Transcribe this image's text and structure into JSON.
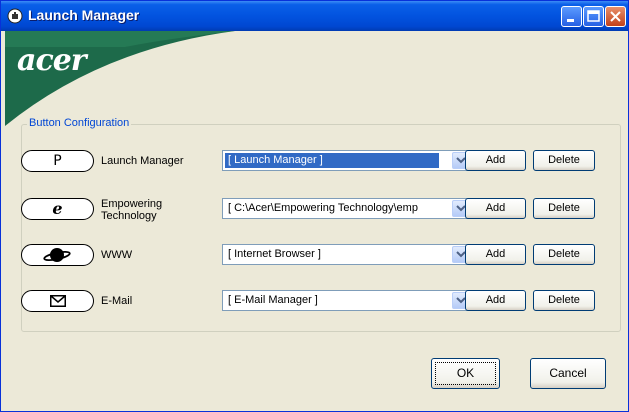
{
  "window": {
    "title": "Launch Manager",
    "brand": "acer",
    "colors": {
      "titlebar": "#0253df",
      "banner": "#1d6a4a",
      "legend": "#0046d5",
      "selection": "#316ac5"
    }
  },
  "group": {
    "legend": "Button Configuration",
    "rows": [
      {
        "key_glyph": "P",
        "label_lines": [
          "Launch Manager"
        ],
        "value": "[ Launch Manager ]",
        "selected": true,
        "add": "Add",
        "delete": "Delete"
      },
      {
        "key_glyph": "e",
        "label_lines": [
          "Empowering",
          "Technology"
        ],
        "value": "[ C:\\Acer\\Empowering Technology\\emp",
        "selected": false,
        "add": "Add",
        "delete": "Delete"
      },
      {
        "key_glyph": "",
        "label_lines": [
          "WWW"
        ],
        "value": "[ Internet Browser ]",
        "selected": false,
        "add": "Add",
        "delete": "Delete"
      },
      {
        "key_glyph": "",
        "label_lines": [
          "E-Mail"
        ],
        "value": "[ E-Mail Manager ]",
        "selected": false,
        "add": "Add",
        "delete": "Delete"
      }
    ]
  },
  "footer": {
    "ok": "OK",
    "cancel": "Cancel"
  },
  "icons": [
    "app-icon",
    "minimize-icon",
    "maximize-icon",
    "close-icon",
    "globe-icon",
    "envelope-icon",
    "chevron-down-icon"
  ]
}
